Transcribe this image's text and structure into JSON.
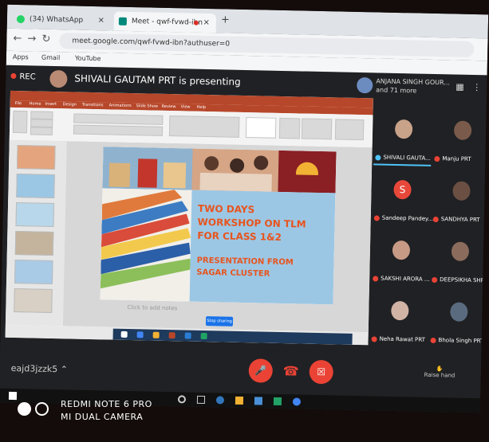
{
  "browser": {
    "tabs": [
      {
        "title": "(34) WhatsApp",
        "close": "×"
      },
      {
        "title": "Meet - qwf-fvwd-ibn",
        "close": "×"
      }
    ],
    "new_tab": "+",
    "url": "meet.google.com/qwf-fvwd-ibn?authuser=0",
    "bookmarks": [
      "Apps",
      "Gmail",
      "YouTube"
    ]
  },
  "meet": {
    "rec_label": "REC",
    "presenting_text": "SHIVALI GAUTAM PRT is presenting",
    "top_participant": "ANJANA SINGH GOUR...",
    "more_count": "and 71 more",
    "meeting_code": "eajd3jzzk5",
    "raise_hand": "Raise hand",
    "participants": [
      {
        "name": "SHIVALI GAUTA...",
        "color": "#c9a28a"
      },
      {
        "name": "Manju PRT",
        "color": "#7a5a4a"
      },
      {
        "name": "Sandeep Pandey...",
        "color": "#e8483a",
        "letter": "S"
      },
      {
        "name": "SANDHYA PRT",
        "color": "#6b4f42"
      },
      {
        "name": "SAKSHI ARORA ...",
        "color": "#c79a86"
      },
      {
        "name": "DEEPSIKHA SHR...",
        "color": "#8b6b5c"
      },
      {
        "name": "Neha Rawat PRT",
        "color": "#d0b3a4"
      },
      {
        "name": "Bhola Singh PRT",
        "color": "#5a6b80"
      }
    ]
  },
  "slide": {
    "line1": "TWO DAYS",
    "line2": "WORKSHOP ON TLM",
    "line3": "FOR CLASS 1&2",
    "line4": "PRESENTATION FROM",
    "line5": "SAGAR CLUSTER",
    "notes_placeholder": "Click to add notes",
    "share_button": "Stop sharing"
  },
  "powerpoint": {
    "tabs": [
      "File",
      "Home",
      "Insert",
      "Design",
      "Transitions",
      "Animations",
      "Slide Show",
      "Review",
      "View",
      "Help"
    ]
  },
  "watermark": {
    "line1": "REDMI NOTE 6 PRO",
    "line2": "MI DUAL CAMERA"
  },
  "colors": {
    "meet_bg": "#202124",
    "powerpoint_red": "#b7472a",
    "slide_title": "#e8541e",
    "slide_box": "#9cc7e4",
    "end_call": "#ea4335"
  }
}
